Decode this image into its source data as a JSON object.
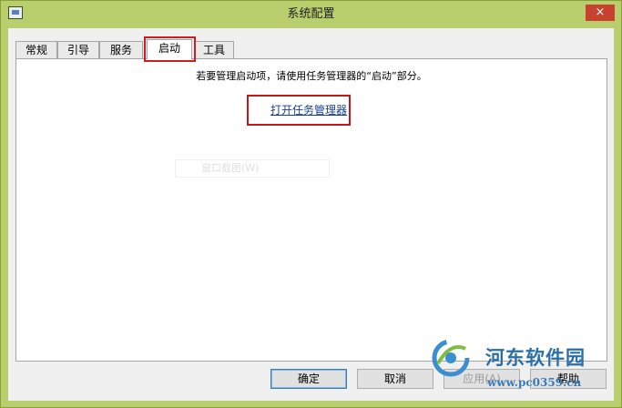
{
  "window": {
    "title": "系统配置",
    "close_label": "×"
  },
  "tabs": [
    {
      "label": "常规"
    },
    {
      "label": "引导"
    },
    {
      "label": "服务"
    },
    {
      "label": "启动",
      "active": true
    },
    {
      "label": "工具"
    }
  ],
  "startup_panel": {
    "info_text": "若要管理启动项，请使用任务管理器的“启动”部分。",
    "open_task_manager_link": "打开任务管理器",
    "ghost_text": "窗口截图(W)"
  },
  "buttons": {
    "ok": "确定",
    "cancel": "取消",
    "apply": "应用(A)",
    "help": "帮助"
  },
  "watermark": {
    "title": "河东软件园",
    "url": "www.pc0359.cn"
  },
  "colors": {
    "window_frame": "#b9ce6d",
    "close": "#c8412f",
    "highlight": "#d01e1e",
    "link": "#1a3f8f"
  }
}
